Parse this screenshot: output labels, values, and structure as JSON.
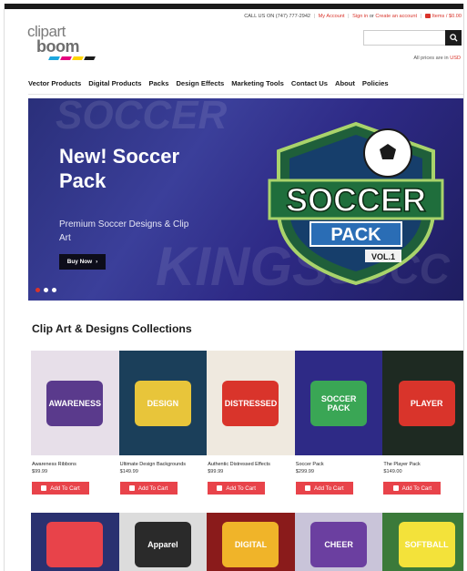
{
  "utility": {
    "call": "CALL US ON (747) 777-2942",
    "my_account": "My Account",
    "sign_in": "Sign in",
    "or": "or",
    "create_account": "Create an account",
    "cart": "Items / $0.00"
  },
  "logo": {
    "line1": "clipart",
    "line2": "boom",
    "colors": [
      "#1ca7df",
      "#e5007e",
      "#ffd400",
      "#1a1a1a"
    ]
  },
  "search": {
    "placeholder": "",
    "icon": "search-icon"
  },
  "prices_note": {
    "text": "All prices are in",
    "currency": "USD"
  },
  "nav": {
    "items": [
      "Vector Products",
      "Digital Products",
      "Packs",
      "Design Effects",
      "Marketing Tools",
      "Contact Us",
      "About",
      "Policies"
    ]
  },
  "hero": {
    "title_line1": "New! Soccer",
    "title_line2": "Pack",
    "subtitle": "Premium Soccer Designs & Clip Art",
    "button": "Buy Now",
    "badge_top": "SOCCER",
    "badge_bottom": "PACK",
    "badge_vol": "VOL.1",
    "slides": 3,
    "active_slide": 1
  },
  "collections": {
    "title": "Clip Art & Designs Collections",
    "button_label": "Add To Cart",
    "row1": [
      {
        "name": "Awareness Ribbons",
        "price": "$99.99",
        "art": "AWARENESS",
        "bg": "#e7dfe9",
        "fg": "#5a3a8c"
      },
      {
        "name": "Ultimate Design Backgrounds",
        "price": "$149.99",
        "art": "DESIGN",
        "bg": "#1b3f5a",
        "fg": "#e8c53a"
      },
      {
        "name": "Authentic Distressed Effects",
        "price": "$99.99",
        "art": "DISTRESSED",
        "bg": "#efe9df",
        "fg": "#d9342b"
      },
      {
        "name": "Soccer Pack",
        "price": "$299.99",
        "art": "SOCCER PACK",
        "bg": "#2e2a86",
        "fg": "#3aa655"
      },
      {
        "name": "The Player Pack",
        "price": "$149.00",
        "art": "PLAYER",
        "bg": "#1e2a22",
        "fg": "#d9342b"
      }
    ],
    "row2": [
      {
        "art": "",
        "bg": "#2a3170",
        "fg": "#e8434a"
      },
      {
        "art": "Apparel",
        "bg": "#dcdcdc",
        "fg": "#2a2a2a"
      },
      {
        "art": "DIGITAL",
        "bg": "#8a1b1b",
        "fg": "#f0b429"
      },
      {
        "art": "CHEER",
        "bg": "#c9c4d9",
        "fg": "#6b3fa0"
      },
      {
        "art": "SOFTBALL",
        "bg": "#3b7a3a",
        "fg": "#f3e23a"
      }
    ]
  }
}
